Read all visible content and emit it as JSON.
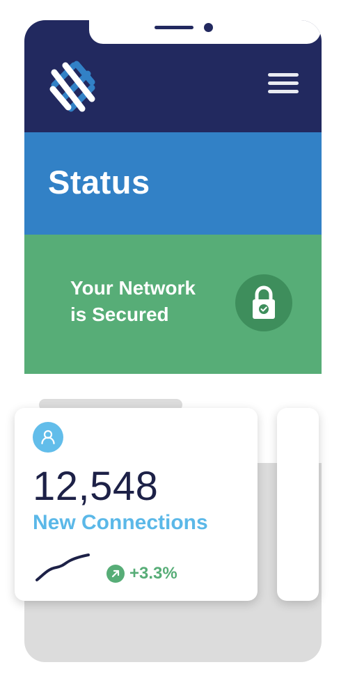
{
  "header": {
    "logo_icon": "woven-knot-logo-icon",
    "menu_icon": "hamburger-menu-icon"
  },
  "title": "Status",
  "status": {
    "line1": "Your Network",
    "line2": "is Secured",
    "icon": "padlock-check-icon",
    "color": "#57ad77"
  },
  "metric_card": {
    "avatar_icon": "user-icon",
    "value": "12,548",
    "label": "New Connections",
    "trend_icon": "arrow-up-right-icon",
    "trend": "+3.3%",
    "trend_color": "#57ad77"
  },
  "colors": {
    "navy": "#22295f",
    "blue": "#3281c6",
    "green": "#57ad77",
    "light_blue": "#5bb8e8"
  }
}
